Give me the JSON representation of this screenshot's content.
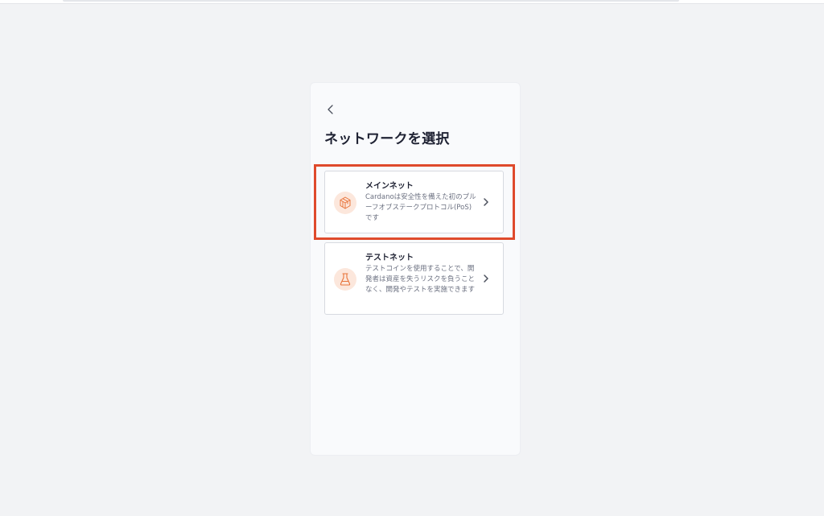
{
  "page": {
    "title": "ネットワークを選択",
    "back_icon": "chevron-left-icon"
  },
  "networks": [
    {
      "title": "メインネット",
      "description": "Cardanoは安全性を備えた初のプルーフオブステークプロトコル(PoS)です",
      "icon": "cube-icon"
    },
    {
      "title": "テストネット",
      "description": "テストコインを使用することで、開発者は資産を失うリスクを負うことなく、開発やテストを実施できます",
      "icon": "flask-icon"
    }
  ],
  "colors": {
    "accent": "#e8743b",
    "icon_bg": "#fce7dc",
    "highlight": "#df4a2c"
  }
}
